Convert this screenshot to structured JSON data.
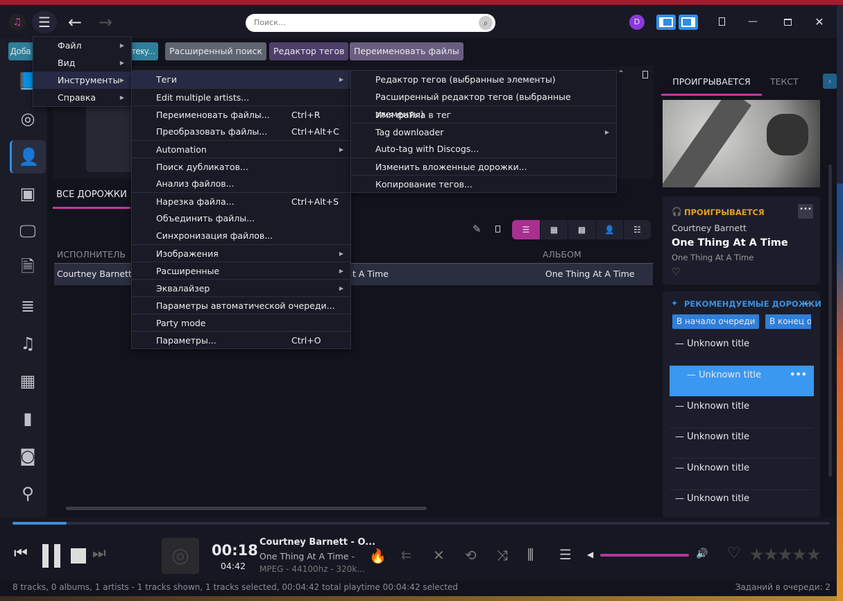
{
  "search": {
    "placeholder": "Поиск..."
  },
  "user_initial": "D",
  "toolbar": [
    "Добавить в библиотеку...",
    "Расширенный поиск",
    "Редактор тегов",
    "Переименовать файлы"
  ],
  "toolbar_visible_fragments": {
    "first_left": "Доба",
    "first_right": "теку..."
  },
  "main_menu": [
    "Файл",
    "Вид",
    "Инструменты",
    "Справка"
  ],
  "tools_menu": [
    {
      "label": "Теги",
      "sub": true
    },
    {
      "label": "Edit multiple artists..."
    },
    {
      "label": "Переименовать файлы...",
      "shortcut": "Ctrl+R"
    },
    {
      "label": "Преобразовать файлы...",
      "shortcut": "Ctrl+Alt+C"
    },
    {
      "label": "Automation",
      "sub": true
    },
    {
      "label": "Поиск дубликатов..."
    },
    {
      "label": "Анализ файлов..."
    },
    {
      "label": "Нарезка файла...",
      "shortcut": "Ctrl+Alt+S"
    },
    {
      "label": "Объединить файлы..."
    },
    {
      "label": "Синхронизация файлов..."
    },
    {
      "label": "Изображения",
      "sub": true
    },
    {
      "label": "Расширенные",
      "sub": true
    },
    {
      "label": "Эквалайзер",
      "sub": true
    },
    {
      "label": "Параметры автоматической очереди..."
    },
    {
      "label": "Party mode"
    },
    {
      "label": "Параметры...",
      "shortcut": "Ctrl+O"
    }
  ],
  "tags_menu": [
    "Редактор тегов (выбранные элементы)",
    "Расширенный редактор тегов (выбранные элементы)",
    "Имя файла в тег",
    "Tag downloader",
    "Auto-tag with Discogs...",
    "Изменить вложенные дорожки...",
    "Копирование тегов..."
  ],
  "main": {
    "tab": "ВСЕ ДОРОЖКИ",
    "col_artist": "ИСПОЛНИТЕЛЬ",
    "col_album": "АЛЬБОМ",
    "row": {
      "artist": "Courtney Barnett",
      "title_fragment": "t A Time",
      "album": "One Thing At A Time"
    }
  },
  "right": {
    "tab_playing": "ПРОИГРЫВАЕТСЯ",
    "tab_lyrics": "ТЕКСТ",
    "now_label": "ПРОИГРЫВАЕТСЯ",
    "artist": "Courtney Barnett",
    "title": "One Thing At A Time",
    "album": "One Thing At A Time",
    "rec_label": "РЕКОМЕНДУЕМЫЕ ДОРОЖКИ",
    "btn_start": "В начало очереди",
    "btn_end": "В конец очереди",
    "recs": [
      "— Unknown title",
      "— Unknown title",
      "— Unknown title",
      "— Unknown title",
      "— Unknown title",
      "— Unknown title"
    ]
  },
  "player": {
    "elapsed": "00:18",
    "total": "04:42",
    "line1": "Courtney Barnett - O...",
    "line2": "One Thing At A Time -",
    "line3": "MPEG - 44100hz - 320k...",
    "progress": 0.066,
    "volume": 1.0,
    "rating": 0
  },
  "status": {
    "left": "8 tracks, 0 albums, 1 artists - 1 tracks shown, 1 tracks selected, 00:04:42 total playtime 00:04:42 selected",
    "right": "Заданий в очереди: 2"
  },
  "colors": {
    "accent": "#c0399e",
    "blue": "#2f8ee8",
    "gold": "#e0a020"
  }
}
